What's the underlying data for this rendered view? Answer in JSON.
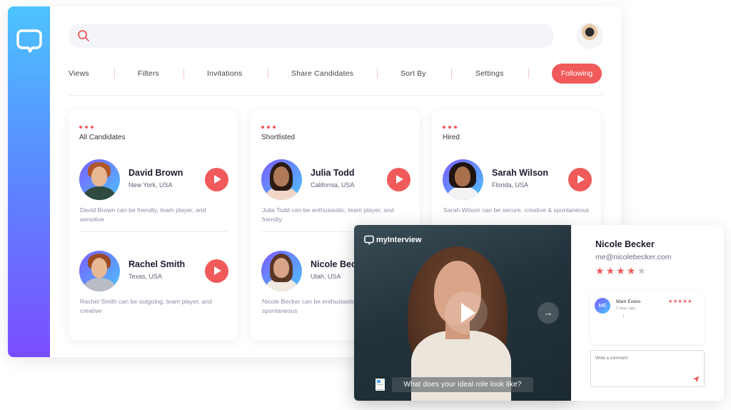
{
  "app": {
    "logo_icon": "chat-bubble-logo-icon",
    "search": {
      "placeholder": "",
      "icon": "search-icon"
    },
    "user_avatar": "user-avatar"
  },
  "nav": {
    "items": [
      "Views",
      "Filters",
      "Invitations",
      "Share Candidates",
      "Sort By",
      "Settings"
    ],
    "following_label": "Following"
  },
  "columns": [
    {
      "title": "All Candidates",
      "candidates": [
        {
          "name": "David Brown",
          "location": "New York, USA",
          "description": "David Brown can be friendly, team player, and sensitive"
        },
        {
          "name": "Rachel Smith",
          "location": "Texas, USA",
          "description": "Rachel Smith can be outgoing, team player, and creative"
        }
      ]
    },
    {
      "title": "Shortlisted",
      "candidates": [
        {
          "name": "Julia Todd",
          "location": "California, USA",
          "description": "Julia Todd can be enthusiastic, team player, and friendly"
        },
        {
          "name": "Nicole Becker",
          "location": "Utah, USA",
          "description": "Nicole Becker can be enthusiastic, team player, and spontaneous"
        }
      ]
    },
    {
      "title": "Hired",
      "candidates": [
        {
          "name": "Sarah Wilson",
          "location": "Florida, USA",
          "description": "Sarah Wilson can be secure, creative & spontaneous"
        }
      ]
    }
  ],
  "video": {
    "brand": "myInterview",
    "question": "What  does your ideal role look like?",
    "next_icon": "→"
  },
  "profile": {
    "name": "Nicole Becker",
    "email": "me@nicolebecker.com",
    "rating": 4,
    "rating_max": 5,
    "review": {
      "initials": "ME",
      "author": "Mark Evans",
      "date": "3 days ago",
      "stars": "★★★★★",
      "text": "!"
    },
    "comment_placeholder": "Write a comment"
  },
  "colors": {
    "accent": "#f05a5a",
    "sidebar_top": "#4cc3ff",
    "sidebar_bottom": "#7b4dff"
  }
}
